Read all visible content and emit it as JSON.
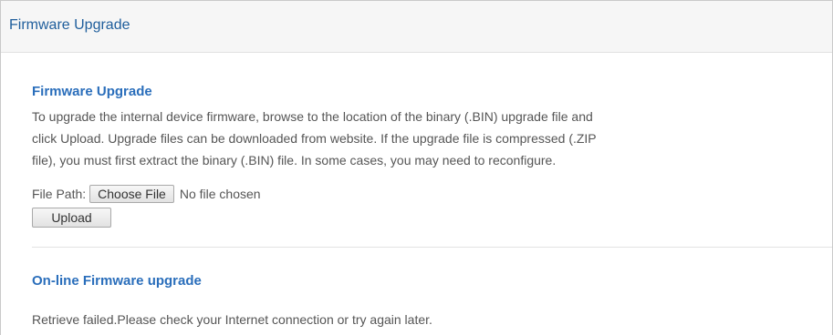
{
  "header": {
    "title": "Firmware Upgrade"
  },
  "firmware_upgrade": {
    "title": "Firmware Upgrade",
    "description_lines": [
      "To upgrade the internal device firmware, browse to the location of the binary (.BIN) upgrade file and",
      "click Upload. Upgrade files can be downloaded from website. If the upgrade file is compressed (.ZIP",
      "file), you must first extract the binary (.BIN) file. In some cases, you may need to reconfigure."
    ],
    "file_path_label": "File Path:",
    "choose_file_label": "Choose File",
    "no_file_text": "No file chosen",
    "upload_label": "Upload"
  },
  "online_upgrade": {
    "title": "On-line Firmware upgrade",
    "message": "Retrieve failed.Please check your Internet connection or try again later."
  }
}
